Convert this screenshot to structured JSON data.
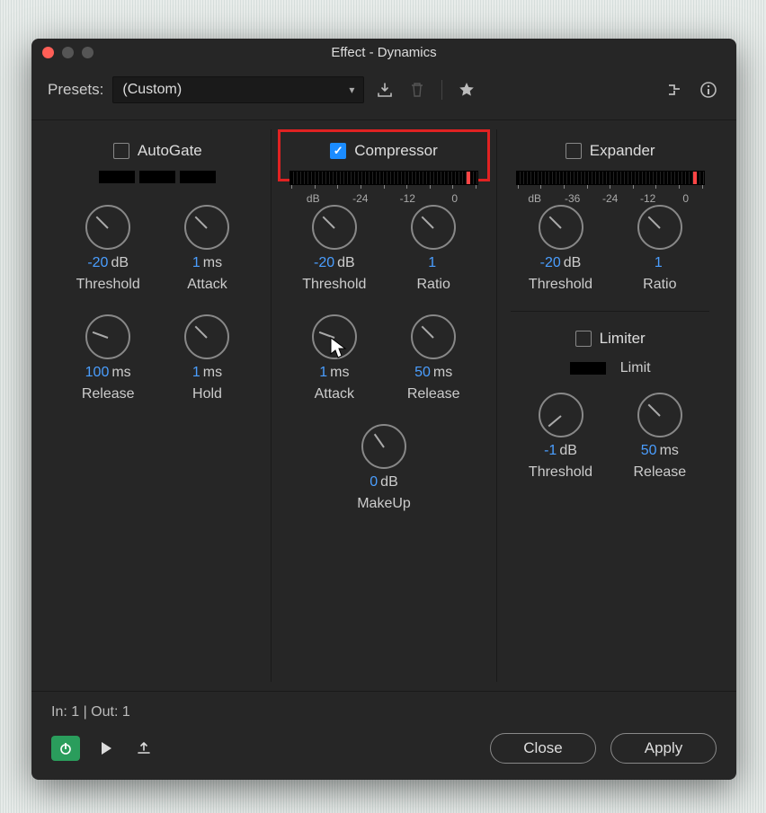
{
  "window": {
    "title": "Effect - Dynamics"
  },
  "presets": {
    "label": "Presets:",
    "value": "(Custom)"
  },
  "icons": {
    "download": "download-icon",
    "trash": "trash-icon",
    "star": "star-icon",
    "route": "routing-icon",
    "info": "info-icon"
  },
  "sections": {
    "autogate": {
      "title": "AutoGate",
      "checked": false,
      "knobs": [
        {
          "value": "-20",
          "unit": "dB",
          "label": "Threshold",
          "angle": 225
        },
        {
          "value": "1",
          "unit": "ms",
          "label": "Attack",
          "angle": 225
        },
        {
          "value": "100",
          "unit": "ms",
          "label": "Release",
          "angle": 200
        },
        {
          "value": "1",
          "unit": "ms",
          "label": "Hold",
          "angle": 225
        }
      ]
    },
    "compressor": {
      "title": "Compressor",
      "checked": true,
      "meter": {
        "labels": [
          "dB",
          "-24",
          "-12",
          "0"
        ]
      },
      "knobs": [
        {
          "value": "-20",
          "unit": "dB",
          "label": "Threshold",
          "angle": 225
        },
        {
          "value": "1",
          "unit": "",
          "label": "Ratio",
          "angle": 225
        },
        {
          "value": "1",
          "unit": "ms",
          "label": "Attack",
          "angle": 200
        },
        {
          "value": "50",
          "unit": "ms",
          "label": "Release",
          "angle": 225
        }
      ],
      "makeup": {
        "value": "0",
        "unit": "dB",
        "label": "MakeUp",
        "angle": 235
      }
    },
    "expander": {
      "title": "Expander",
      "checked": false,
      "meter": {
        "labels": [
          "dB",
          "-36",
          "-24",
          "-12",
          "0"
        ]
      },
      "knobs": [
        {
          "value": "-20",
          "unit": "dB",
          "label": "Threshold",
          "angle": 225
        },
        {
          "value": "1",
          "unit": "",
          "label": "Ratio",
          "angle": 225
        }
      ]
    },
    "limiter": {
      "title": "Limiter",
      "checked": false,
      "limit_label": "Limit",
      "knobs": [
        {
          "value": "-1",
          "unit": "dB",
          "label": "Threshold",
          "angle": 140
        },
        {
          "value": "50",
          "unit": "ms",
          "label": "Release",
          "angle": 225
        }
      ]
    }
  },
  "footer": {
    "io": "In: 1 | Out: 1",
    "close": "Close",
    "apply": "Apply"
  }
}
